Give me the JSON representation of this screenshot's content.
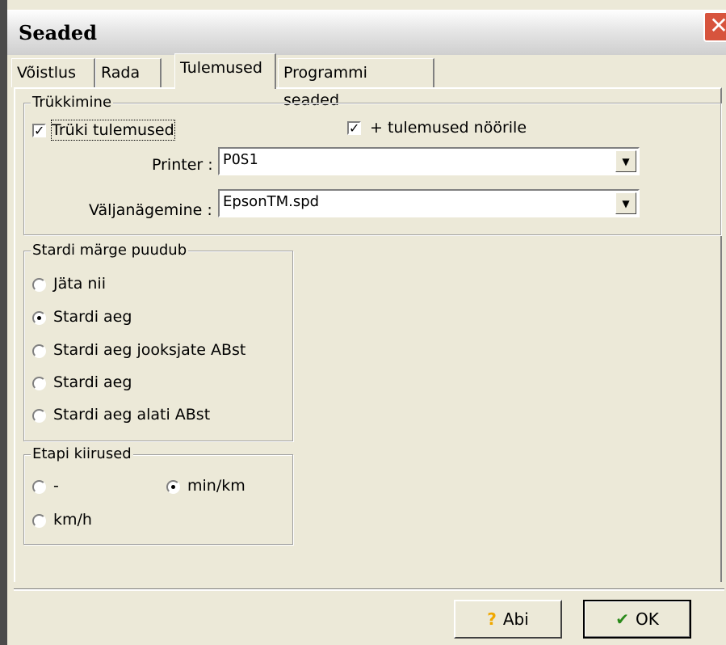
{
  "window": {
    "title": "Seaded",
    "close_glyph": "✕"
  },
  "tabs": [
    {
      "label": "Võistlus"
    },
    {
      "label": "Rada"
    },
    {
      "label": "Tulemused",
      "active": true
    },
    {
      "label": "Programmi seaded"
    }
  ],
  "printing": {
    "group_label": "Trükkimine",
    "print_results": {
      "label": "Trüki tulemused",
      "checked": true
    },
    "results_on_string": {
      "label": "+ tulemused nöörile",
      "checked": true
    },
    "printer": {
      "label": "Printer :",
      "value": "POS1"
    },
    "appearance": {
      "label": "Väljanägemine :",
      "value": "EpsonTM.spd"
    }
  },
  "start_mark": {
    "group_label": "Stardi märge puudub",
    "options": [
      {
        "label": "Jäta nii",
        "selected": false
      },
      {
        "label": "Stardi aeg",
        "selected": true
      },
      {
        "label": "Stardi aeg jooksjate ABst",
        "selected": false
      },
      {
        "label": "Stardi aeg",
        "selected": false
      },
      {
        "label": "Stardi aeg alati ABst",
        "selected": false
      }
    ]
  },
  "stage_speeds": {
    "group_label": "Etapi kiirused",
    "options": [
      {
        "label": "-",
        "selected": false
      },
      {
        "label": "min/km",
        "selected": true
      },
      {
        "label": "km/h",
        "selected": false
      }
    ]
  },
  "buttons": {
    "help": {
      "label": "Abi",
      "icon": "question-icon",
      "icon_glyph": "?"
    },
    "ok": {
      "label": "OK",
      "icon": "checkmark-icon",
      "icon_glyph": "✔"
    }
  },
  "colors": {
    "close": "#d7543d",
    "help_icon": "#f0a800",
    "ok_icon": "#2a8a1a"
  }
}
